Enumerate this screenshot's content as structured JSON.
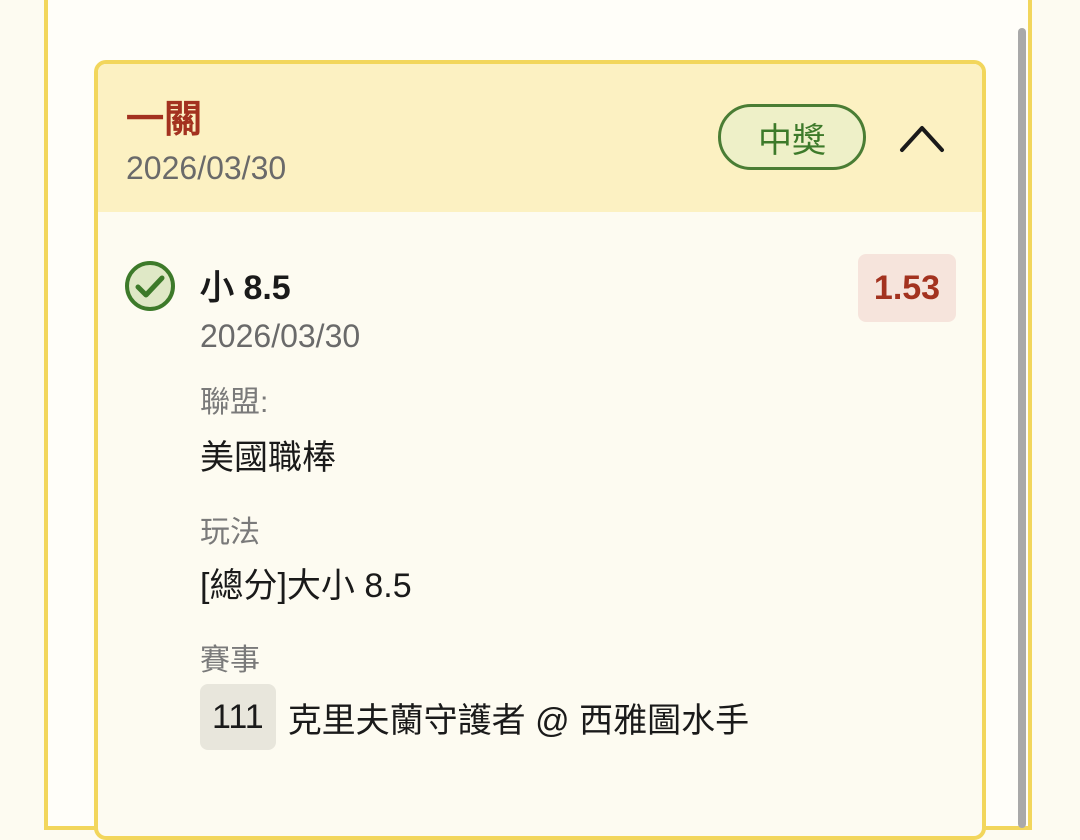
{
  "bet": {
    "type_label": "一關",
    "date": "2026/03/30",
    "status": "中獎",
    "collapse_icon": "chevron-up-icon"
  },
  "selection": {
    "label": "小 8.5",
    "date": "2026/03/30",
    "odds": "1.53",
    "status_icon": "check-circle-icon",
    "status_color": "#3d7a2a"
  },
  "details": {
    "league_label": "聯盟:",
    "league_value": "美國職棒",
    "market_label": "玩法",
    "market_value": "[總分]大小 8.5",
    "event_label": "賽事",
    "event_number": "111",
    "event_name": "克里夫蘭守護者 @ 西雅圖水手"
  },
  "colors": {
    "accent_red": "#a3321f",
    "border_yellow": "#f2d65c",
    "header_bg": "#fcf1c2",
    "win_green": "#3d7a2a"
  }
}
